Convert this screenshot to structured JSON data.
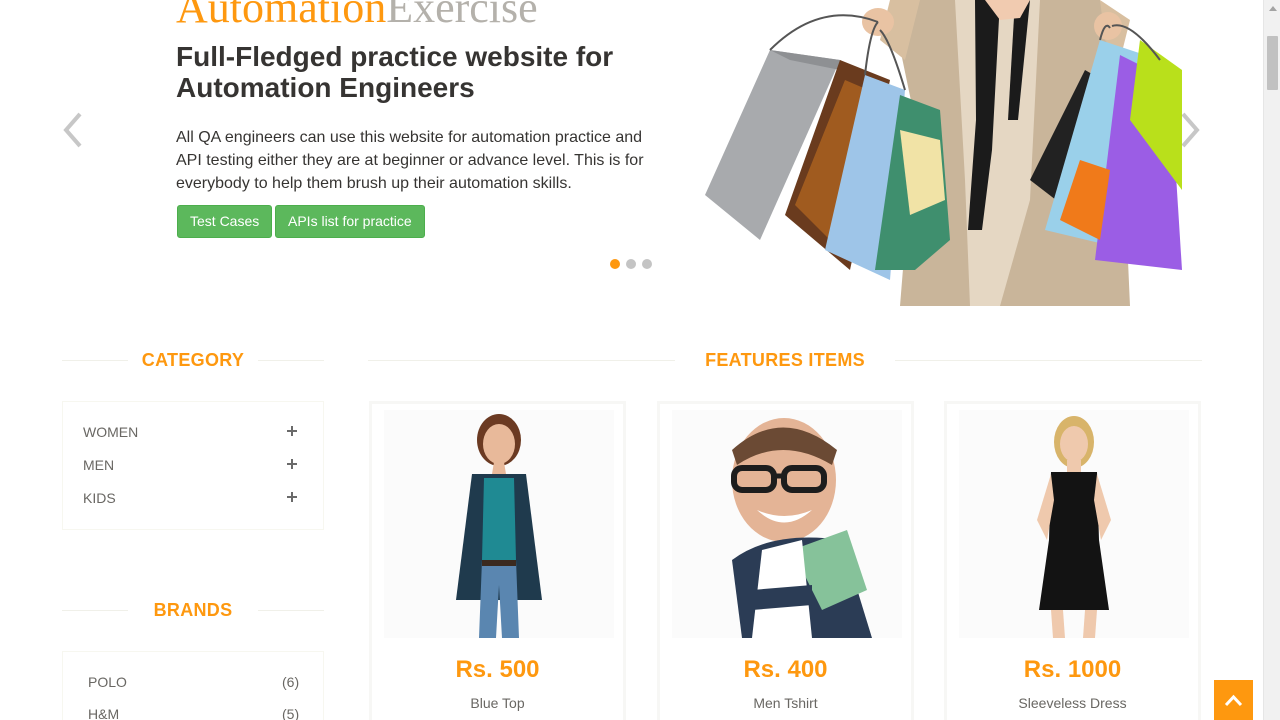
{
  "hero": {
    "brand_part1": "Automation",
    "brand_part2": "Exercise",
    "heading": "Full-Fledged practice website for Automation Engineers",
    "text": "All QA engineers can use this website for automation practice and API testing either they are at beginner or advance level. This is for everybody to help them brush up their automation skills.",
    "button_test_cases": "Test Cases",
    "button_apis": "APIs list for practice",
    "slide_count": 3,
    "active_slide": 1
  },
  "sidebar": {
    "category_title": "CATEGORY",
    "categories": [
      "WOMEN",
      "MEN",
      "KIDS"
    ],
    "brands_title": "BRANDS",
    "brands": [
      {
        "name": "POLO",
        "count": "(6)"
      },
      {
        "name": "H&M",
        "count": "(5)"
      }
    ]
  },
  "features": {
    "title": "FEATURES ITEMS",
    "products": [
      {
        "price": "Rs. 500",
        "name": "Blue Top",
        "image": "woman-in-blue-top"
      },
      {
        "price": "Rs. 400",
        "name": "Men Tshirt",
        "image": "man-with-glasses"
      },
      {
        "price": "Rs. 1000",
        "name": "Sleeveless Dress",
        "image": "woman-in-black-dress"
      }
    ]
  },
  "colors": {
    "accent": "#fe980f",
    "button_green": "#5cb85c",
    "text_dark": "#363432",
    "text_body": "#696763"
  },
  "icons": {
    "prev": "chevron-left-icon",
    "next": "chevron-right-icon",
    "expand": "plus-icon",
    "scroll_top": "chevron-up-icon"
  }
}
